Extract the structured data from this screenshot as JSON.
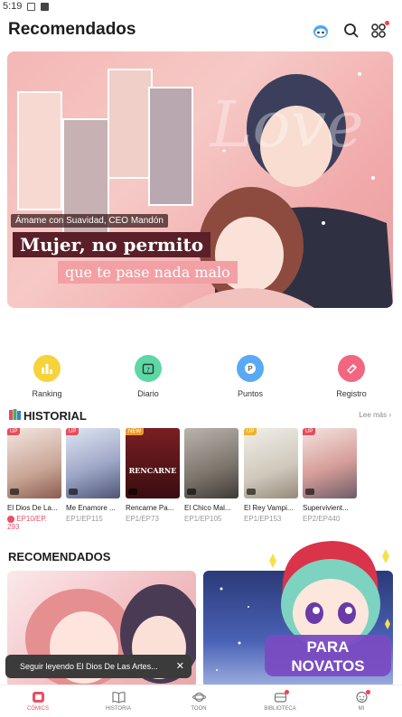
{
  "status_bar": {
    "time": "5:19"
  },
  "header": {
    "title": "Recomendados"
  },
  "banner": {
    "subtitle": "Ámame con Suavidad, CEO Mandón",
    "line1": "Mujer, no permito",
    "line2": "que te pase nada malo",
    "watermark": "Love"
  },
  "quick_actions": [
    {
      "label": "Ranking",
      "color": "#f6d33b",
      "icon": "chart-icon"
    },
    {
      "label": "Diario",
      "color": "#5cd8a4",
      "icon": "calendar-icon"
    },
    {
      "label": "Puntos",
      "color": "#5aa9f5",
      "icon": "points-icon"
    },
    {
      "label": "Registro",
      "color": "#f2677f",
      "icon": "tag-icon"
    }
  ],
  "history": {
    "title": "HISTORIAL",
    "see_more": "Lee más",
    "items": [
      {
        "name": "El Dios De La...",
        "ep": "EP10/EP.",
        "ep2": "293",
        "tag": "UP",
        "tag_color": "#e84c5b"
      },
      {
        "name": "Me Enamore ...",
        "ep": "EP1/EP115",
        "tag": "UP",
        "tag_color": "#e84c5b"
      },
      {
        "name": "Rencarne Pa...",
        "ep": "EP1/EP73",
        "tag": "NEW",
        "tag_color": "#f09a2c",
        "cover_text": "RENCARNE"
      },
      {
        "name": "El Chico Mal...",
        "ep": "EP1/EP105"
      },
      {
        "name": "El Rey Vampi...",
        "ep": "EP1/EP153",
        "tag": "UP",
        "tag_color": "#f0b32c"
      },
      {
        "name": "Supervivient...",
        "ep": "EP2/EP440",
        "tag": "UP",
        "tag_color": "#e84c5b"
      }
    ]
  },
  "recommended": {
    "title": "RECOMENDADOS"
  },
  "toast": {
    "text": "Seguir leyendo El Dios De Las Artes...",
    "close": "✕"
  },
  "mascot": {
    "line1": "PARA",
    "line2": "NOVATOS"
  },
  "bottom_nav": [
    {
      "label": "CÓMICS",
      "active": true
    },
    {
      "label": "HISTORIA"
    },
    {
      "label": "TOON"
    },
    {
      "label": "BIBLIOTECA"
    },
    {
      "label": "MI"
    }
  ],
  "colors": {
    "accent": "#e85064",
    "banner_pink": "#f4b7b5"
  }
}
